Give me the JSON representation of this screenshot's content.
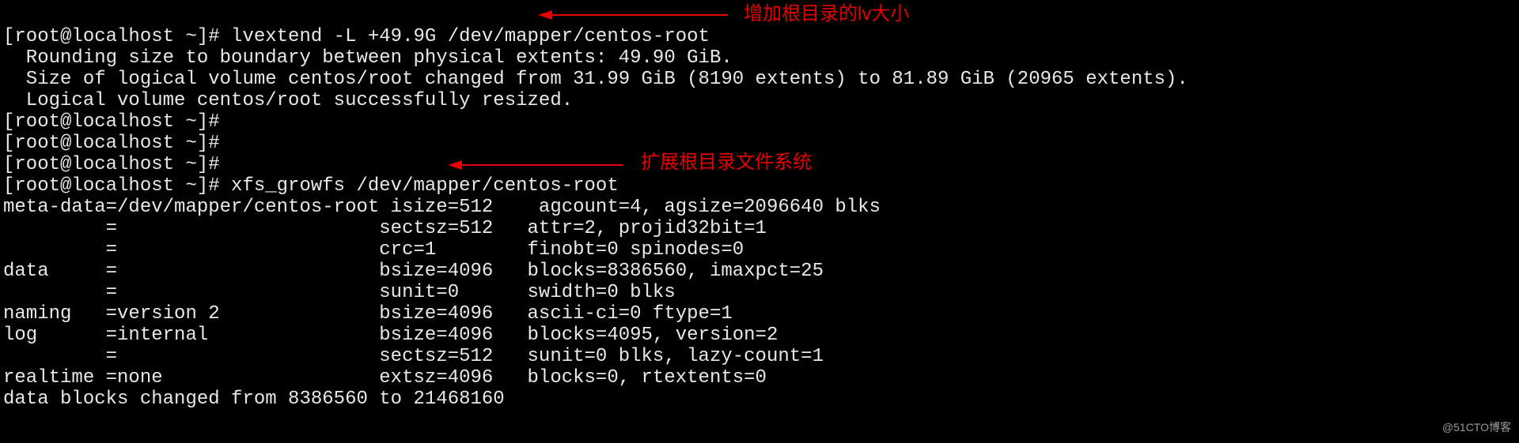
{
  "prompt": "[root@localhost ~]# ",
  "cmd1": "lvextend -L +49.9G /dev/mapper/centos-root",
  "out1_l1": "  Rounding size to boundary between physical extents: 49.90 GiB.",
  "out1_l2": "  Size of logical volume centos/root changed from 31.99 GiB (8190 extents) to 81.89 GiB (20965 extents).",
  "out1_l3": "  Logical volume centos/root successfully resized.",
  "cmd2": "xfs_growfs /dev/mapper/centos-root",
  "xfs_l1": "meta-data=/dev/mapper/centos-root isize=512    agcount=4, agsize=2096640 blks",
  "xfs_l2": "         =                       sectsz=512   attr=2, projid32bit=1",
  "xfs_l3": "         =                       crc=1        finobt=0 spinodes=0",
  "xfs_l4": "data     =                       bsize=4096   blocks=8386560, imaxpct=25",
  "xfs_l5": "         =                       sunit=0      swidth=0 blks",
  "xfs_l6": "naming   =version 2              bsize=4096   ascii-ci=0 ftype=1",
  "xfs_l7": "log      =internal               bsize=4096   blocks=4095, version=2",
  "xfs_l8": "         =                       sectsz=512   sunit=0 blks, lazy-count=1",
  "xfs_l9": "realtime =none                   extsz=4096   blocks=0, rtextents=0",
  "xfs_l10": "data blocks changed from 8386560 to 21468160",
  "annotation1": "增加根目录的lv大小",
  "annotation2": "扩展根目录文件系统",
  "watermark": "@51CTO博客"
}
